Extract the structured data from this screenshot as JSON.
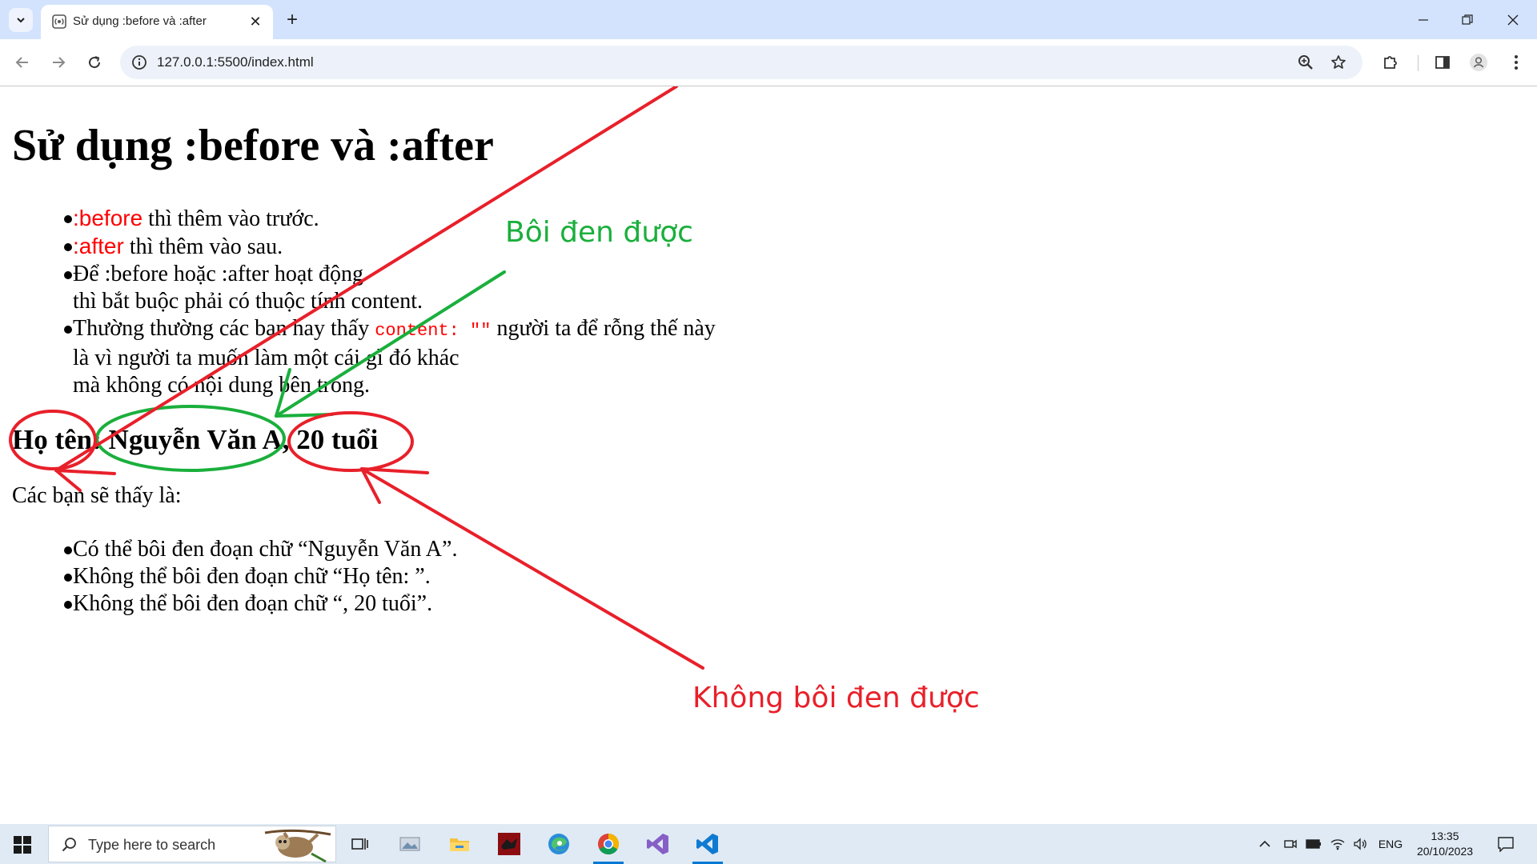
{
  "browser": {
    "tab_title": "Sử dụng :before và :after",
    "url": "127.0.0.1:5500/index.html"
  },
  "page": {
    "title": "Sử dụng :before và :after",
    "list1": {
      "item1_red": ":before",
      "item1_rest": " thì thêm vào trước.",
      "item2_red": ":after",
      "item2_rest": " thì thêm vào sau.",
      "item3_line1": "Để :before hoặc :after hoạt động",
      "item3_line2": "thì bắt buộc phải có thuộc tính content.",
      "item4_pre": "Thường thường các bạn hay thấy ",
      "item4_code": "content: \"\"",
      "item4_post": " người ta để rỗng thế này",
      "item4_line2": "là vì người ta muốn làm một cái gì đó khác",
      "item4_line3": "mà không có nội dung bên trong."
    },
    "info": {
      "before": "Họ tên: ",
      "name": "Nguyễn Văn A",
      "after": ", 20 tuổi"
    },
    "paragraph": "Các bạn sẽ thấy là:",
    "list2": [
      "Có thể bôi đen đoạn chữ   “Nguyễn Văn A”.",
      "Không thể bôi đen đoạn chữ   “Họ tên: ”.",
      "Không thể bôi đen đoạn chữ   “, 20 tuổi”."
    ],
    "annotation_green": "Bôi đen được",
    "annotation_red": "Không bôi đen được"
  },
  "taskbar": {
    "search_placeholder": "Type here to search",
    "language": "ENG",
    "time": "13:35",
    "date": "20/10/2023"
  },
  "colors": {
    "annotation_green": "#1aaf3c",
    "annotation_red": "#e8202a",
    "content_red": "#ff0000"
  }
}
